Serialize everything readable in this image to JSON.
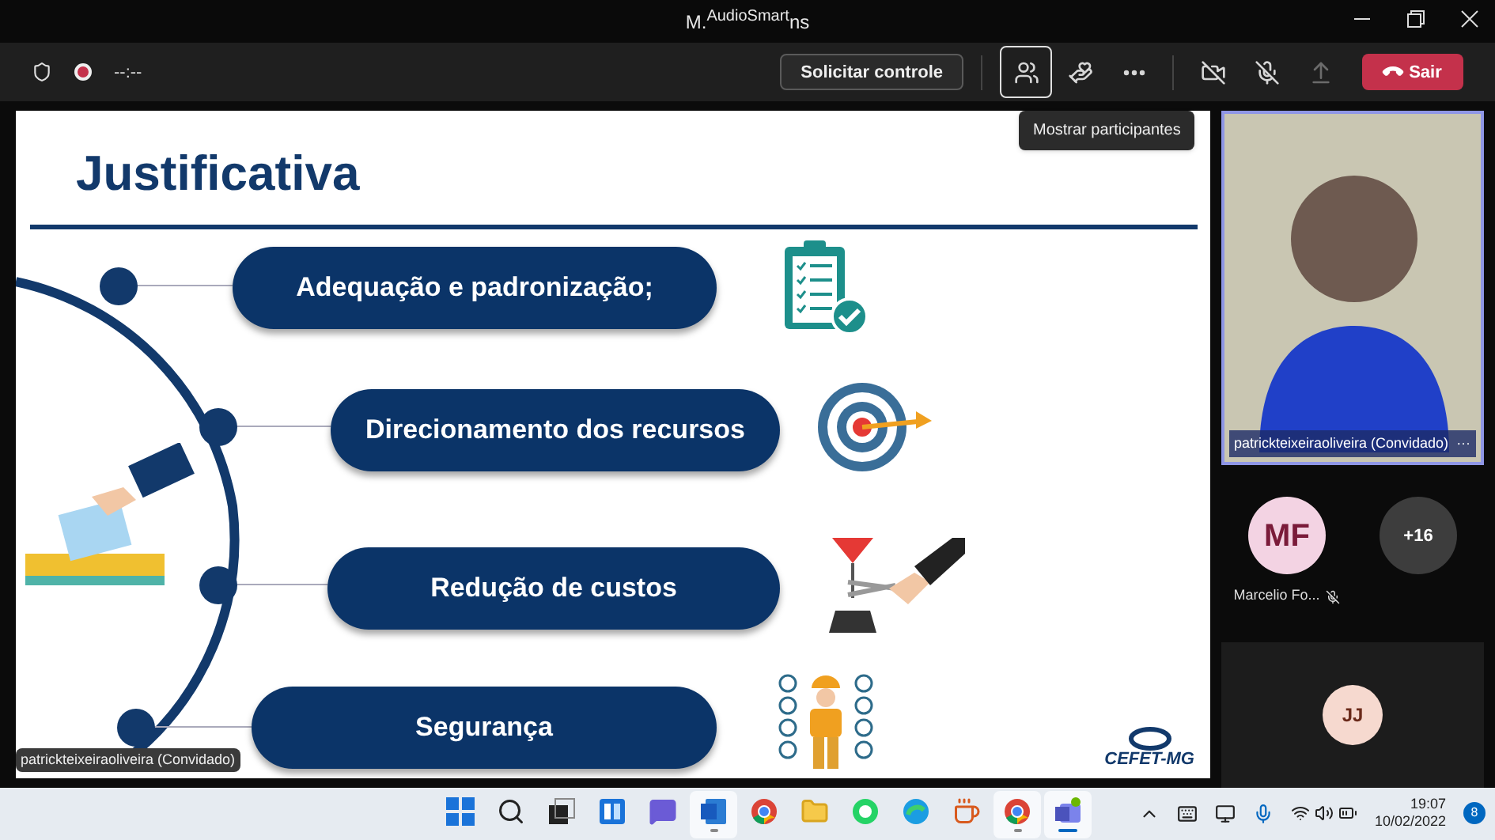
{
  "window": {
    "title_start": "M.",
    "title_overlay": "AudioSmart",
    "title_end": "ns"
  },
  "toolbar": {
    "timer": "--:--",
    "recording": true,
    "request_control": "Solicitar controle",
    "buttons": [
      {
        "kind": "participants",
        "selected": true
      },
      {
        "kind": "reactions",
        "selected": false
      },
      {
        "kind": "more",
        "selected": false
      },
      {
        "kind": "camera-off",
        "selected": false
      },
      {
        "kind": "mic-off",
        "selected": false
      },
      {
        "kind": "share",
        "selected": false
      }
    ],
    "leave": "Sair"
  },
  "tooltip": "Mostrar participantes",
  "slide": {
    "title": "Justificativa",
    "items": [
      {
        "label": "Adequação e padronização;",
        "kind": "checklist"
      },
      {
        "label": "Direcionamento dos recursos",
        "kind": "target"
      },
      {
        "label": "Redução de custos",
        "kind": "costs"
      },
      {
        "label": "Segurança",
        "kind": "worker"
      }
    ],
    "logo": "CEFET-MG",
    "presenter": "patrickteixeiraoliveira (Convidado)"
  },
  "participants": {
    "video_name": "patrickteixeiraoliveira (Convidado)",
    "more": "···",
    "tiles": [
      {
        "initials": "MF",
        "name": "Marcelio Fo...",
        "muted": true,
        "color": "#f3d3e3"
      },
      {
        "initials": "+16",
        "color": "#3d3d3d"
      }
    ],
    "bottom": {
      "initials": "JJ",
      "color": "#f6d9cf"
    }
  },
  "taskbar": {
    "apps": [
      {
        "kind": "start",
        "active": false
      },
      {
        "kind": "search",
        "active": false
      },
      {
        "kind": "taskview",
        "active": false
      },
      {
        "kind": "widgets",
        "active": false
      },
      {
        "kind": "chat",
        "active": false
      },
      {
        "kind": "word",
        "active": true
      },
      {
        "kind": "chrome",
        "active": false
      },
      {
        "kind": "folder",
        "active": false
      },
      {
        "kind": "whatsapp",
        "active": false
      },
      {
        "kind": "edge",
        "active": false
      },
      {
        "kind": "java",
        "active": false
      },
      {
        "kind": "chrome-profile",
        "active": true
      },
      {
        "kind": "teams",
        "active": true
      }
    ],
    "time": "19:07",
    "date": "10/02/2022",
    "badge": "8"
  }
}
